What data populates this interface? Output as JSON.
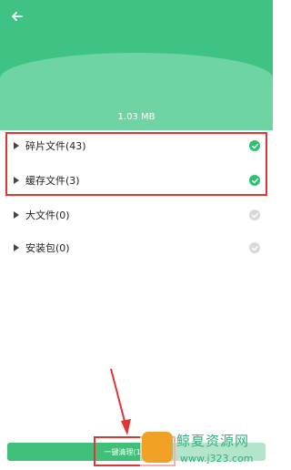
{
  "header": {
    "total_size": "1.03 MB",
    "color": "#3ec385"
  },
  "items": [
    {
      "label": "碎片文件(43)",
      "checked": true
    },
    {
      "label": "缓存文件(3)",
      "checked": true
    },
    {
      "label": "大文件(0)",
      "checked": false
    },
    {
      "label": "安装包(0)",
      "checked": false
    }
  ],
  "button": {
    "label": "一键清理(1.03 MB)",
    "color": "#3fbf78"
  },
  "watermark": {
    "text": "鲸夏资源网",
    "url": "www.j323.com"
  },
  "icons": {
    "back": "back-arrow-icon",
    "expand": "triangle-right-icon",
    "check": "check-circle-icon"
  }
}
